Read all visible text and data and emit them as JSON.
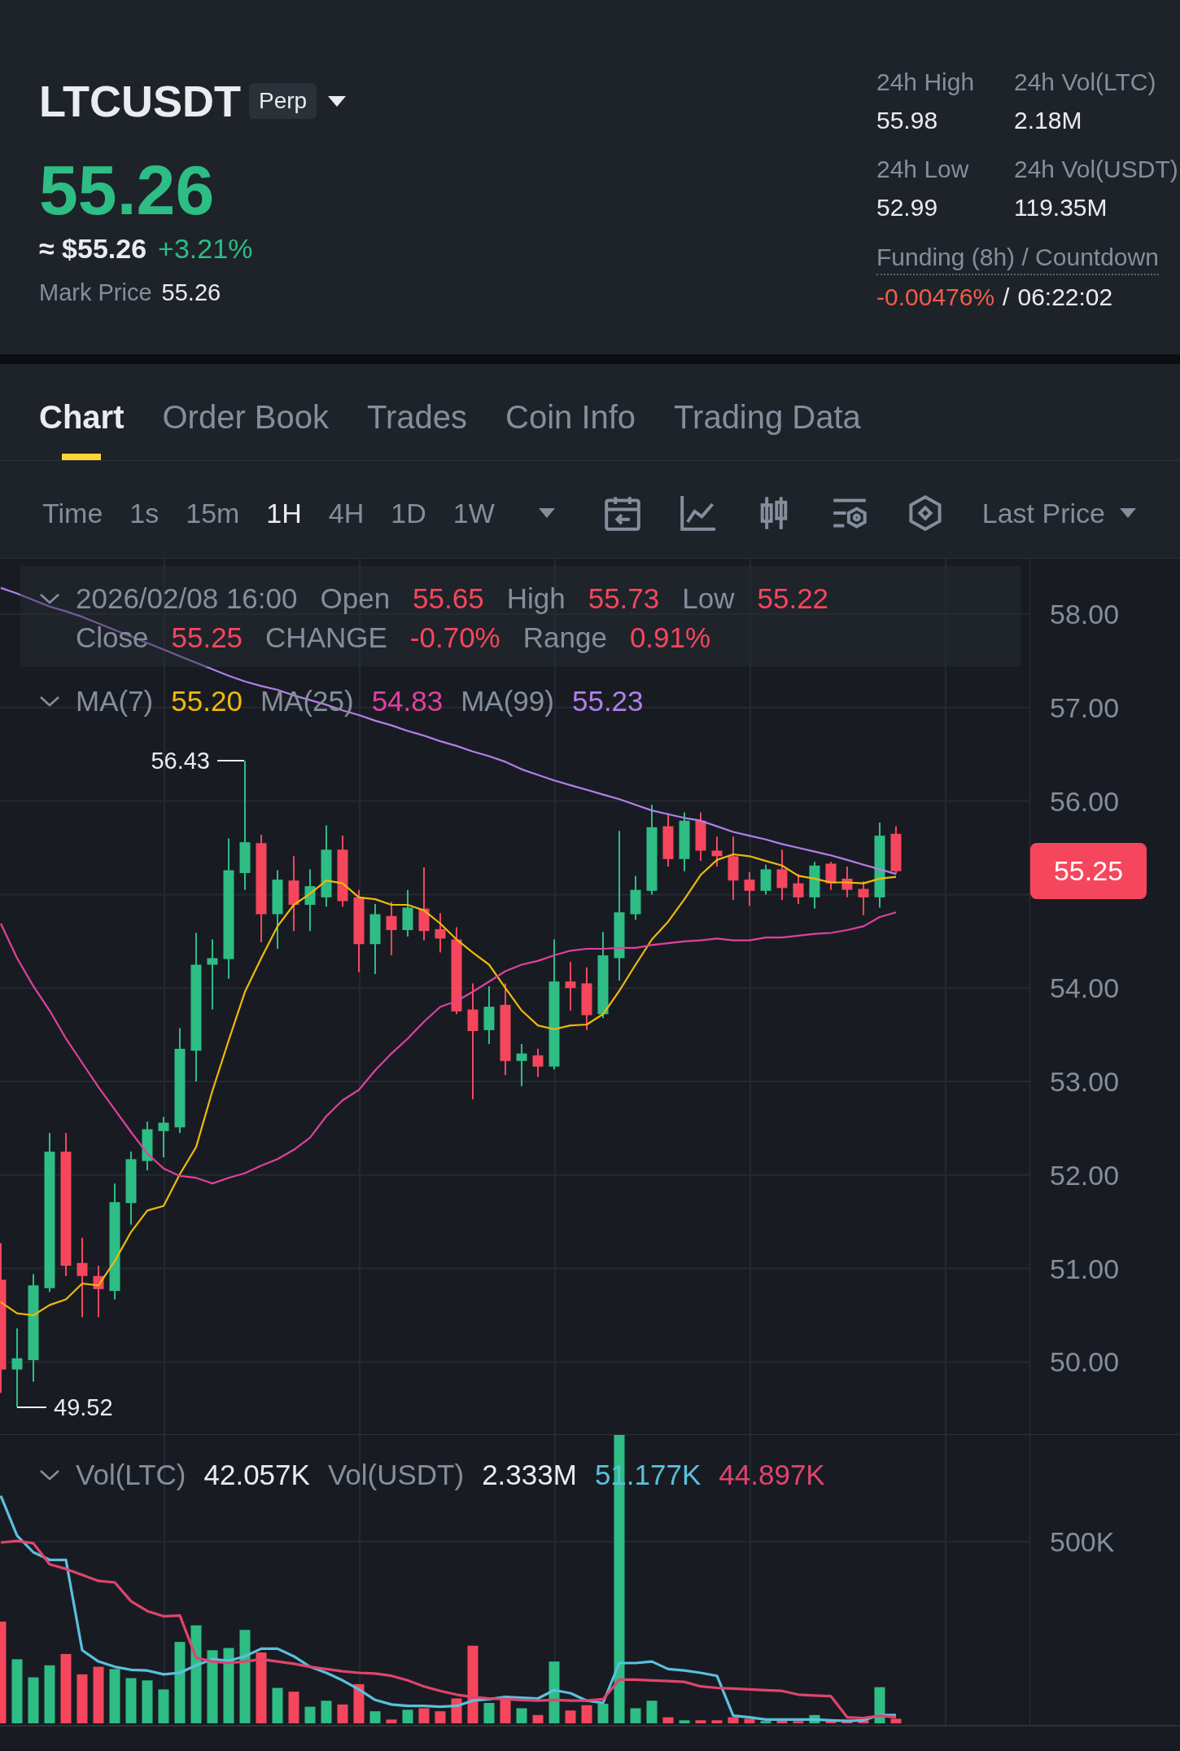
{
  "header": {
    "symbol": "LTCUSDT",
    "contract_badge": "Perp",
    "price_up": true,
    "last_price": "55.26",
    "price_usd": "≈ $55.26",
    "change_percent": "+3.21%",
    "mark_price_label": "Mark Price",
    "mark_price": "55.26",
    "stats": [
      {
        "label": "24h High",
        "value": "55.98"
      },
      {
        "label": "24h Vol(LTC)",
        "value": "2.18M"
      },
      {
        "label": "24h Low",
        "value": "52.99"
      },
      {
        "label": "24h Vol(USDT)",
        "value": "119.35M"
      }
    ],
    "funding": {
      "label": "Funding (8h) / Countdown",
      "rate": "-0.00476%",
      "rate_negative": true,
      "separator": "/",
      "countdown": "06:22:02"
    }
  },
  "tabs": [
    {
      "label": "Chart",
      "selected": true
    },
    {
      "label": "Order Book",
      "selected": false
    },
    {
      "label": "Trades",
      "selected": false
    },
    {
      "label": "Coin Info",
      "selected": false
    },
    {
      "label": "Trading Data",
      "selected": false
    }
  ],
  "toolbar": {
    "intervals": [
      {
        "label": "Time",
        "selected": false
      },
      {
        "label": "1s",
        "selected": false
      },
      {
        "label": "15m",
        "selected": false
      },
      {
        "label": "1H",
        "selected": true
      },
      {
        "label": "4H",
        "selected": false
      },
      {
        "label": "1D",
        "selected": false
      },
      {
        "label": "1W",
        "selected": false
      }
    ],
    "price_type": "Last Price"
  },
  "chart": {
    "last_candle_up": false,
    "ohlc_legend": {
      "date": "2026/02/08 16:00",
      "fields": [
        {
          "label": "Open",
          "value": "55.65"
        },
        {
          "label": "High",
          "value": "55.73"
        },
        {
          "label": "Low",
          "value": "55.22"
        },
        {
          "label": "Close",
          "value": "55.25"
        },
        {
          "label": "CHANGE",
          "value": "-0.70%"
        },
        {
          "label": "Range",
          "value": "0.91%"
        }
      ]
    },
    "ma_legend": [
      {
        "label": "MA(7)",
        "value": "55.20",
        "color": "#f0b90b"
      },
      {
        "label": "MA(25)",
        "value": "54.83",
        "color": "#e040a0"
      },
      {
        "label": "MA(99)",
        "value": "55.23",
        "color": "#b37feb"
      }
    ],
    "high_marker": "56.43",
    "low_marker": "49.52",
    "price_axis": {
      "ticks_above": [
        "58.00",
        "57.00",
        "56.00"
      ],
      "current_price": "55.25",
      "ticks_below": [
        "54.00",
        "53.00",
        "52.00",
        "51.00",
        "50.00"
      ]
    }
  },
  "volume": {
    "legend": [
      {
        "label": "Vol(LTC)",
        "value": "42.057K",
        "color": "#eaecef"
      },
      {
        "label": "Vol(USDT)",
        "value": "2.333M",
        "color": "#eaecef"
      },
      {
        "value": "51.177K",
        "color": "#5bc0de"
      },
      {
        "value": "44.897K",
        "color": "#e0446e"
      }
    ],
    "axis": [
      "500K"
    ]
  }
}
